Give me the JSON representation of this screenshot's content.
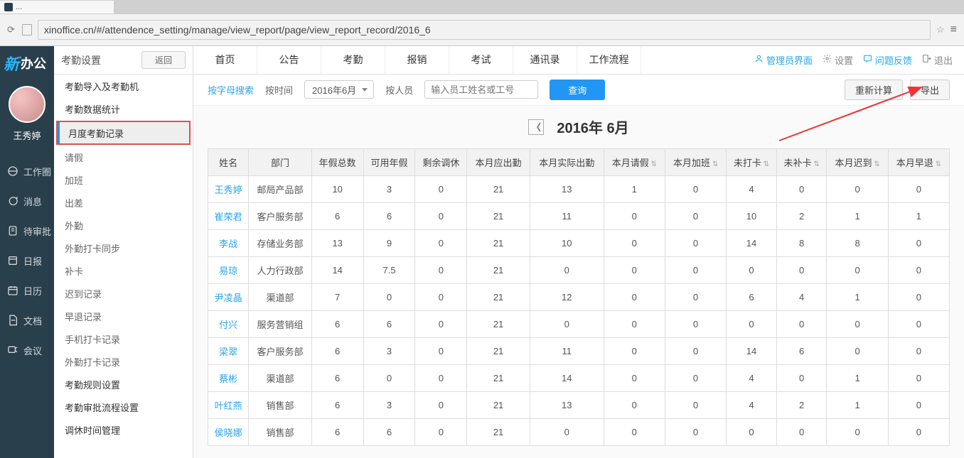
{
  "browser": {
    "tab_title": "...",
    "url": "xinoffice.cn/#/attendence_setting/manage/view_report/page/view_report_record/2016_6"
  },
  "logo_text": "办公",
  "username": "王秀婷",
  "left_nav": [
    {
      "icon": "workspace",
      "label": "工作圈"
    },
    {
      "icon": "message",
      "label": "消息"
    },
    {
      "icon": "approval",
      "label": "待审批"
    },
    {
      "icon": "daily",
      "label": "日报"
    },
    {
      "icon": "calendar",
      "label": "日历"
    },
    {
      "icon": "docs",
      "label": "文档"
    },
    {
      "icon": "meeting",
      "label": "会议"
    }
  ],
  "sidepanel": {
    "title": "考勤设置",
    "back": "返回",
    "items": [
      {
        "label": "考勤导入及考勤机",
        "dark": true
      },
      {
        "label": "考勤数据统计",
        "dark": true
      },
      {
        "label": "月度考勤记录",
        "dark": true,
        "active": true,
        "highlight": true
      },
      {
        "label": "请假"
      },
      {
        "label": "加班"
      },
      {
        "label": "出差"
      },
      {
        "label": "外勤"
      },
      {
        "label": "外勤打卡同步"
      },
      {
        "label": "补卡"
      },
      {
        "label": "迟到记录"
      },
      {
        "label": "早退记录"
      },
      {
        "label": "手机打卡记录"
      },
      {
        "label": "外勤打卡记录"
      },
      {
        "label": "考勤规则设置",
        "dark": true
      },
      {
        "label": "考勤审批流程设置",
        "dark": true
      },
      {
        "label": "调休时间管理",
        "dark": true
      }
    ]
  },
  "topnav": {
    "items": [
      "首页",
      "公告",
      "考勤",
      "报销",
      "考试",
      "通讯录",
      "工作流程"
    ],
    "right": [
      {
        "label": "管理员界面",
        "color": "blue",
        "icon": "user"
      },
      {
        "label": "设置",
        "color": "gray",
        "icon": "gear"
      },
      {
        "label": "问题反馈",
        "color": "blue",
        "icon": "feedback"
      },
      {
        "label": "退出",
        "color": "gray",
        "icon": "exit"
      }
    ]
  },
  "filter": {
    "alpha": "按字母搜索",
    "bytime": "按时间",
    "month_sel": "2016年6月",
    "byperson": "按人员",
    "input_ph": "输入员工姓名或工号",
    "search": "查询",
    "recalc": "重新计算",
    "export": "导出"
  },
  "month_title": "2016年 6月",
  "table": {
    "headers": [
      "姓名",
      "部门",
      "年假总数",
      "可用年假",
      "剩余调休",
      "本月应出勤",
      "本月实际出勤",
      "本月请假",
      "本月加班",
      "未打卡",
      "未补卡",
      "本月迟到",
      "本月早退"
    ],
    "sortable": [
      false,
      false,
      false,
      false,
      false,
      false,
      false,
      true,
      true,
      true,
      true,
      true,
      true
    ],
    "rows": [
      {
        "name": "王秀婷",
        "dept": "邮局产品部",
        "v": [
          10,
          3,
          0,
          21,
          13,
          1,
          0,
          4,
          0,
          0,
          0
        ]
      },
      {
        "name": "崔荣君",
        "dept": "客户服务部",
        "v": [
          6,
          6,
          0,
          21,
          11,
          0,
          0,
          10,
          2,
          1,
          1
        ]
      },
      {
        "name": "李战",
        "dept": "存储业务部",
        "v": [
          13,
          9,
          0,
          21,
          10,
          0,
          0,
          14,
          8,
          8,
          0
        ]
      },
      {
        "name": "易琼",
        "dept": "人力行政部",
        "v": [
          14,
          7.5,
          0,
          21,
          0,
          0,
          0,
          0,
          0,
          0,
          0
        ]
      },
      {
        "name": "尹凌晶",
        "dept": "渠道部",
        "v": [
          7,
          0,
          0,
          21,
          12,
          0,
          0,
          6,
          4,
          1,
          0
        ]
      },
      {
        "name": "付兴",
        "dept": "服务营销组",
        "v": [
          6,
          6,
          0,
          21,
          0,
          0,
          0,
          0,
          0,
          0,
          0
        ]
      },
      {
        "name": "梁翠",
        "dept": "客户服务部",
        "v": [
          6,
          3,
          0,
          21,
          11,
          0,
          0,
          14,
          6,
          0,
          0
        ]
      },
      {
        "name": "蔡彬",
        "dept": "渠道部",
        "v": [
          6,
          0,
          0,
          21,
          14,
          0,
          0,
          4,
          0,
          1,
          0
        ]
      },
      {
        "name": "叶红燕",
        "dept": "销售部",
        "v": [
          6,
          3,
          0,
          21,
          13,
          0,
          0,
          4,
          2,
          1,
          0
        ]
      },
      {
        "name": "侯晓娜",
        "dept": "销售部",
        "v": [
          6,
          6,
          0,
          21,
          0,
          0,
          0,
          0,
          0,
          0,
          0
        ]
      }
    ]
  }
}
